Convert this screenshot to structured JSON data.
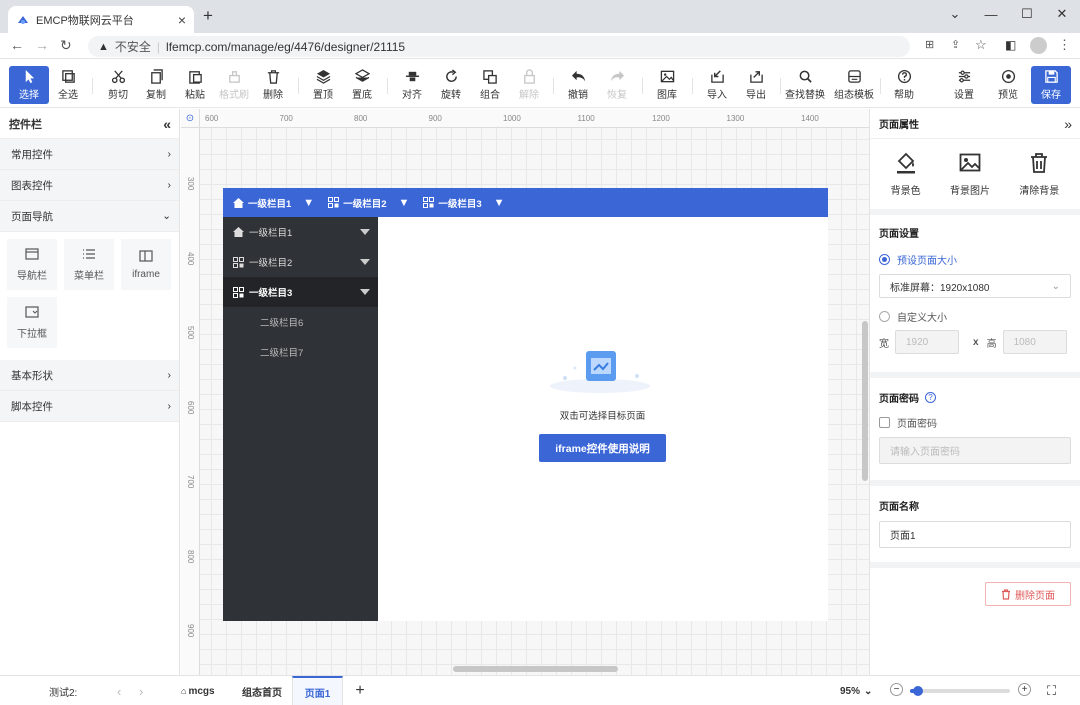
{
  "browser": {
    "tab_title": "EMCP物联网云平台",
    "new_tab": "+",
    "insecure": "不安全",
    "url": "lfemcp.com/manage/eg/4476/designer/21115"
  },
  "toolbar": {
    "items": [
      {
        "label": "选择",
        "icon": "cursor-icon"
      },
      {
        "label": "全选",
        "icon": "select-all-icon"
      },
      {
        "label": "剪切",
        "icon": "scissors-icon"
      },
      {
        "label": "复制",
        "icon": "copy-icon"
      },
      {
        "label": "粘贴",
        "icon": "paste-icon"
      },
      {
        "label": "格式刷",
        "icon": "format-brush-icon"
      },
      {
        "label": "删除",
        "icon": "trash-icon"
      },
      {
        "label": "置顶",
        "icon": "layers-top-icon"
      },
      {
        "label": "置底",
        "icon": "layers-bottom-icon"
      },
      {
        "label": "对齐",
        "icon": "align-icon"
      },
      {
        "label": "旋转",
        "icon": "rotate-icon"
      },
      {
        "label": "组合",
        "icon": "group-icon"
      },
      {
        "label": "解除",
        "icon": "lock-icon"
      },
      {
        "label": "撤销",
        "icon": "undo-icon"
      },
      {
        "label": "恢复",
        "icon": "redo-icon"
      },
      {
        "label": "图库",
        "icon": "image-icon"
      },
      {
        "label": "导入",
        "icon": "import-icon"
      },
      {
        "label": "导出",
        "icon": "export-icon"
      },
      {
        "label": "查找替换",
        "icon": "search-icon"
      },
      {
        "label": "组态模板",
        "icon": "template-icon"
      },
      {
        "label": "帮助",
        "icon": "help-icon"
      },
      {
        "label": "设置",
        "icon": "settings-icon"
      },
      {
        "label": "预览",
        "icon": "preview-icon"
      },
      {
        "label": "保存",
        "icon": "save-icon"
      }
    ]
  },
  "left_panel": {
    "title": "控件栏",
    "categories": [
      "常用控件",
      "图表控件",
      "页面导航",
      "基本形状",
      "脚本控件"
    ],
    "components": [
      "导航栏",
      "菜单栏",
      "iframe",
      "下拉框"
    ]
  },
  "rulers": {
    "x": [
      "600",
      "700",
      "800",
      "900",
      "1000",
      "1100",
      "1200",
      "1300",
      "1400"
    ],
    "y": [
      "300",
      "400",
      "500",
      "600",
      "700",
      "800",
      "900"
    ]
  },
  "design_page": {
    "top_nav": [
      "一级栏目1",
      "一级栏目2",
      "一级栏目3"
    ],
    "side_nav": [
      {
        "label": "一级栏目1",
        "level": 1
      },
      {
        "label": "一级栏目2",
        "level": 1
      },
      {
        "label": "一级栏目3",
        "level": 1
      },
      {
        "label": "二级栏目6",
        "level": 2
      },
      {
        "label": "二级栏目7",
        "level": 2
      }
    ],
    "hint": "双击可选择目标页面",
    "iframe_button": "iframe控件使用说明"
  },
  "right_panel": {
    "title": "页面属性",
    "bg_actions": [
      "背景色",
      "背景图片",
      "清除背景"
    ],
    "page_settings_title": "页面设置",
    "preset_label": "预设页面大小",
    "preset_value": "标准屏幕：1920x1080",
    "custom_label": "自定义大小",
    "width_label": "宽",
    "width_value": "1920",
    "x_label": "x",
    "height_label": "高",
    "height_value": "1080",
    "password_title": "页面密码",
    "password_checkbox": "页面密码",
    "password_placeholder": "请输入页面密码",
    "name_title": "页面名称",
    "name_value": "页面1",
    "delete_button": "删除页面"
  },
  "bottom": {
    "project": "测试2:",
    "tabs": [
      "mcgs",
      "组态首页",
      "页面1"
    ],
    "zoom": "95%",
    "zoom_level": 0.08
  },
  "colors": {
    "accent": "#3a66d6",
    "side_nav": "#2f3236",
    "danger": "#e05a5a"
  }
}
